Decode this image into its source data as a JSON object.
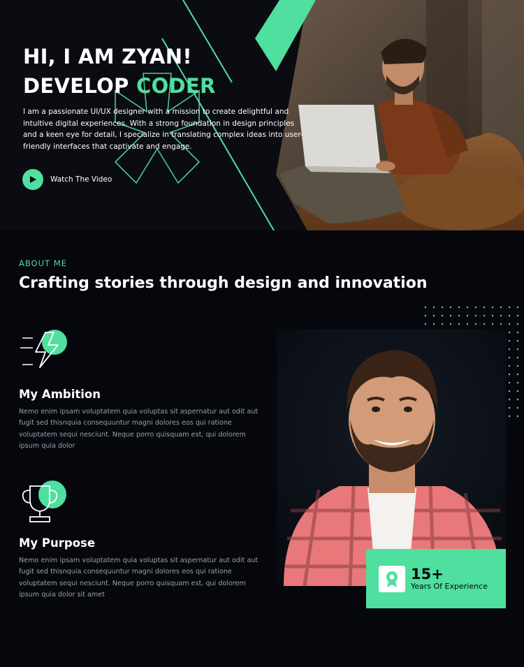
{
  "hero": {
    "line1": "HI, I AM ZYAN!",
    "line2_white": "DEVELOP",
    "line2_accent": "CODER",
    "description": "I am a passionate UI/UX designer with a mission to create delightful and intuitive digital experiences. With a strong foundation in design principles and a keen eye for detail, I specialize in translating complex ideas into user-friendly interfaces that captivate and engage.",
    "watch_label": "Watch The Video",
    "photo_icon": "man-with-laptop-photo",
    "play_icon": "play-icon"
  },
  "about": {
    "label": "ABOUT ME",
    "title": "Crafting stories through design and innovation",
    "features": [
      {
        "icon": "bolt-icon",
        "title": "My Ambition",
        "text": "Nemo enim ipsam voluptatem quia voluptas sit aspernatur aut odit aut fugit sed thisnquia consequuntur magni dolores eos qui ratione voluptatem sequi nesciunt. Neque porro quisquam est, qui dolorem ipsum quia dolor"
      },
      {
        "icon": "trophy-icon",
        "title": "My Purpose",
        "text": "Nemo enim ipsam voluptatem quia voluptas sit aspernatur aut odit aut fugit sed thisnquia consequuntur magni dolores eos qui ratione voluptatem sequi nesciunt. Neque porro quisquam est, qui dolorem ipsum quia dolor sit amet"
      }
    ],
    "experience_number": "15+",
    "experience_label": "Years Of Experience",
    "experience_icon": "award-icon"
  },
  "colors": {
    "accent": "#4fdf9e",
    "background": "#05070d"
  }
}
